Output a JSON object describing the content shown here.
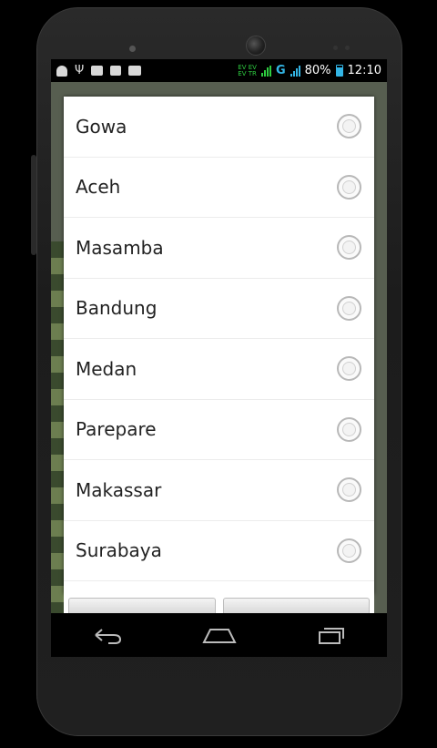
{
  "status_bar": {
    "battery_percent": "80%",
    "time": "12:10",
    "network": "G",
    "ev_top": "EV EV",
    "ev_bottom": "EV TR"
  },
  "dialog": {
    "options": [
      {
        "label": "Gowa",
        "selected": false
      },
      {
        "label": "Aceh",
        "selected": false
      },
      {
        "label": "Masamba",
        "selected": false
      },
      {
        "label": "Bandung",
        "selected": false
      },
      {
        "label": "Medan",
        "selected": false
      },
      {
        "label": "Parepare",
        "selected": false
      },
      {
        "label": "Makassar",
        "selected": false
      },
      {
        "label": "Surabaya",
        "selected": false
      }
    ]
  },
  "nav_bar": {
    "icons": [
      "back-icon",
      "home-icon",
      "recent-apps-icon"
    ]
  },
  "colors": {
    "accent": "#33b5e5",
    "dialog_bg": "#ffffff",
    "status_bar_bg": "#000000"
  }
}
